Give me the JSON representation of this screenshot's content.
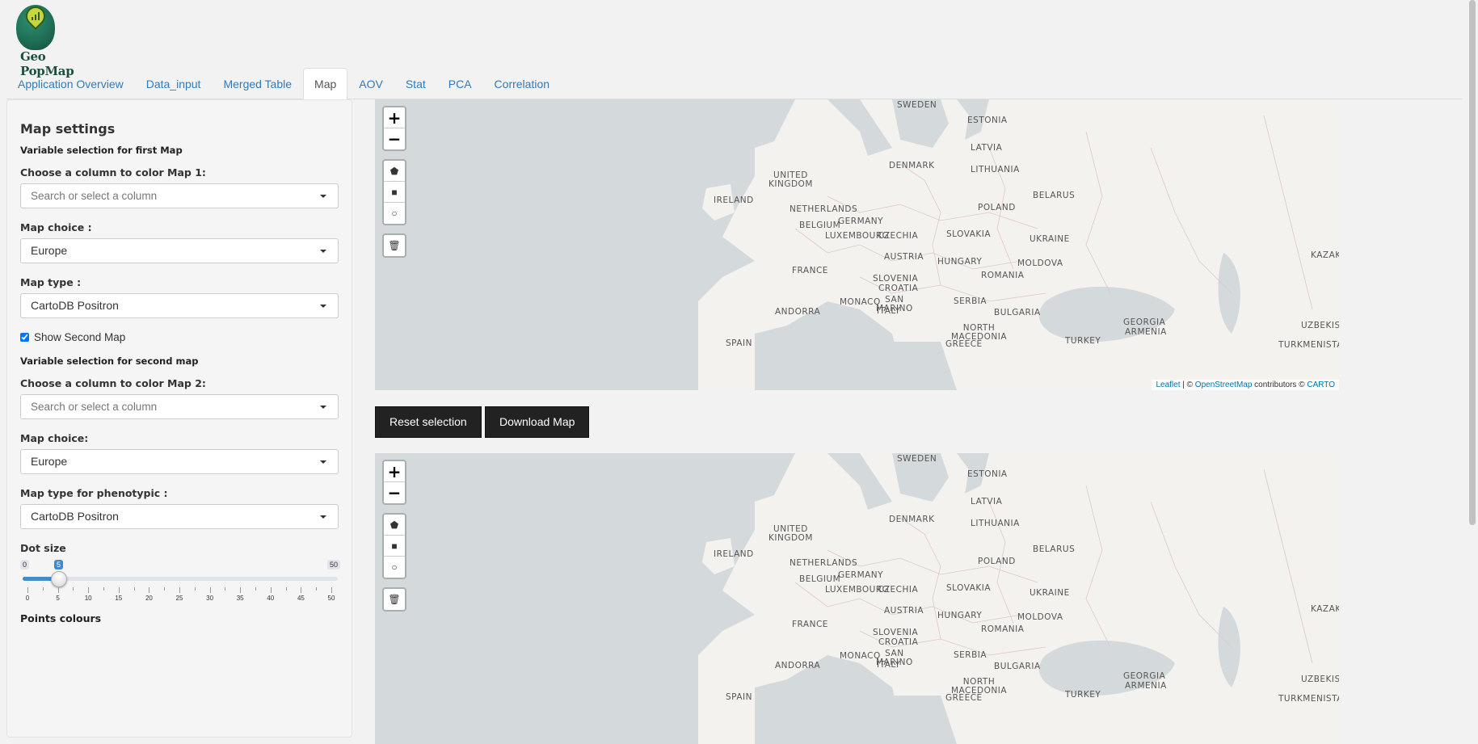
{
  "app": {
    "logo_text": "Geo PopMap"
  },
  "tabs": [
    {
      "label": "Application Overview",
      "active": false
    },
    {
      "label": "Data_input",
      "active": false
    },
    {
      "label": "Merged Table",
      "active": false
    },
    {
      "label": "Map",
      "active": true
    },
    {
      "label": "AOV",
      "active": false
    },
    {
      "label": "Stat",
      "active": false
    },
    {
      "label": "PCA",
      "active": false
    },
    {
      "label": "Correlation",
      "active": false
    }
  ],
  "sidebar": {
    "title": "Map settings",
    "first_map_heading": "Variable selection for first Map",
    "color_map1_label": "Choose a column to color Map 1:",
    "color_map1_placeholder": "Search or select a column",
    "map_choice1_label": "Map choice :",
    "map_choice1_value": "Europe",
    "map_type1_label": "Map type :",
    "map_type1_value": "CartoDB Positron",
    "show_second_label": "Show Second Map",
    "show_second_checked": true,
    "second_map_heading": "Variable selection for second map",
    "color_map2_label": "Choose a column to color Map 2:",
    "color_map2_placeholder": "Search or select a column",
    "map_choice2_label": "Map choice:",
    "map_choice2_value": "Europe",
    "map_type2_label": "Map type for phenotypic :",
    "map_type2_value": "CartoDB Positron",
    "dot_size_label": "Dot size",
    "dot_size": {
      "min": "0",
      "max": "50",
      "value": "5",
      "ticks": [
        "0",
        "5",
        "10",
        "15",
        "20",
        "25",
        "30",
        "35",
        "40",
        "45",
        "50"
      ]
    },
    "points_colours_label": "Points colours"
  },
  "map": {
    "zoom_in": "+",
    "zoom_out": "−",
    "attribution": {
      "leaflet": "Leaflet",
      "sep": " | © ",
      "osm": "OpenStreetMap",
      "contrib": " contributors © ",
      "carto": "CARTO"
    },
    "labels": [
      {
        "text": "SWEDEN"
      },
      {
        "text": "ESTONIA"
      },
      {
        "text": "LATVIA"
      },
      {
        "text": "DENMARK"
      },
      {
        "text": "LITHUANIA"
      },
      {
        "text": "UNITED\nKINGDOM"
      },
      {
        "text": "IRELAND"
      },
      {
        "text": "NETHERLANDS"
      },
      {
        "text": "BELARUS"
      },
      {
        "text": "GERMANY"
      },
      {
        "text": "POLAND"
      },
      {
        "text": "BELGIUM"
      },
      {
        "text": "LUXEMBOURG"
      },
      {
        "text": "CZECHIA"
      },
      {
        "text": "SLOVAKIA"
      },
      {
        "text": "UKRAINE"
      },
      {
        "text": "FRANCE"
      },
      {
        "text": "AUSTRIA"
      },
      {
        "text": "HUNGARY"
      },
      {
        "text": "MOLDOVA"
      },
      {
        "text": "KAZAKHS"
      },
      {
        "text": "SLOVENIA"
      },
      {
        "text": "CROATIA"
      },
      {
        "text": "ROMANIA"
      },
      {
        "text": "SAN\nMARINO"
      },
      {
        "text": "MONACO"
      },
      {
        "text": "ANDORRA"
      },
      {
        "text": "ITALY"
      },
      {
        "text": "SERBIA"
      },
      {
        "text": "BULGARIA"
      },
      {
        "text": "NORTH\nMACEDONIA"
      },
      {
        "text": "GEORGIA"
      },
      {
        "text": "ARMENIA"
      },
      {
        "text": "UZBEKISTAN"
      },
      {
        "text": "SPAIN"
      },
      {
        "text": "TURKEY"
      },
      {
        "text": "GREECE"
      },
      {
        "text": "TURKMENISTAN"
      }
    ]
  },
  "buttons": {
    "reset": "Reset selection",
    "download": "Download Map"
  }
}
